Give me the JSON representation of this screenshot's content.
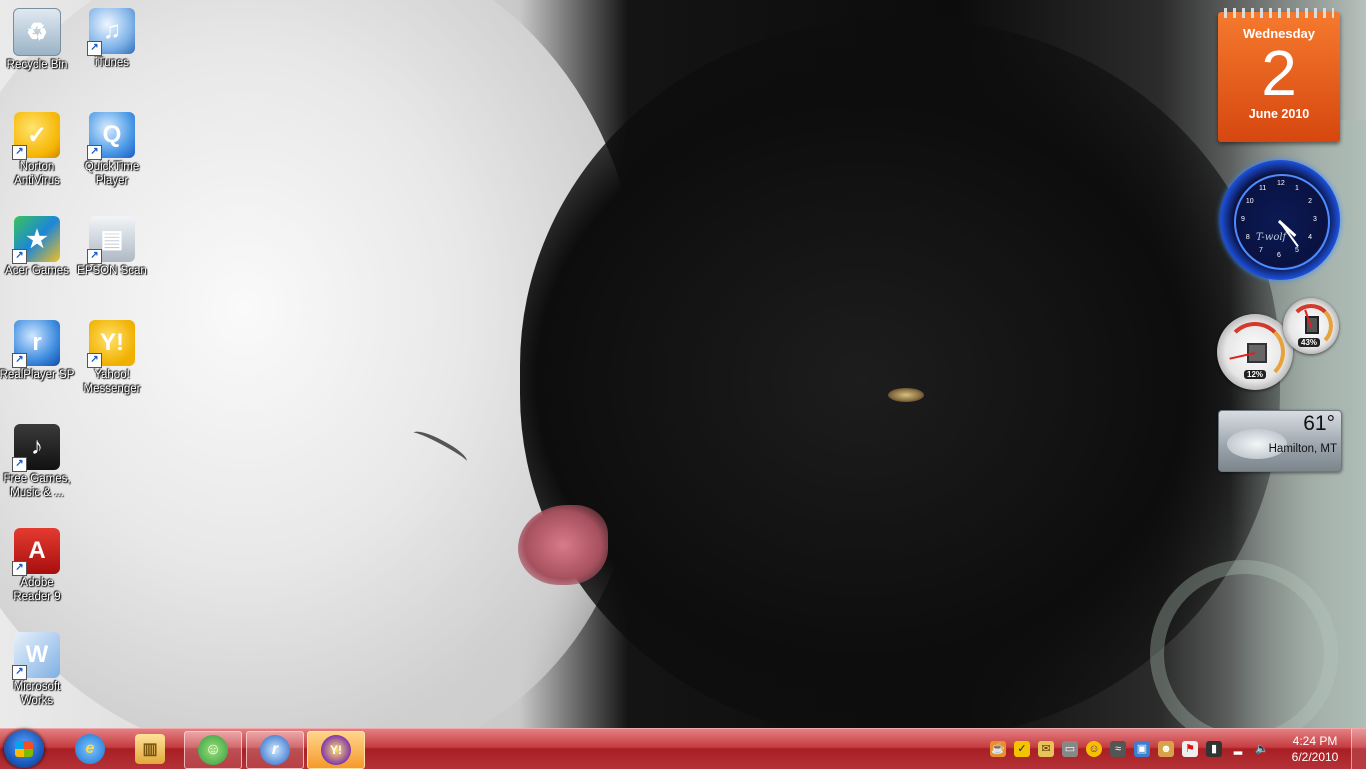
{
  "desktop": {
    "icons": [
      {
        "label": "Recycle Bin",
        "icon": "recycle-bin-icon",
        "glyph": "♻"
      },
      {
        "label": "iTunes",
        "icon": "itunes-icon",
        "glyph": "♫"
      },
      {
        "label": "Norton AntiVirus",
        "icon": "norton-antivirus-icon",
        "glyph": "✓"
      },
      {
        "label": "QuickTime Player",
        "icon": "quicktime-icon",
        "glyph": "Q"
      },
      {
        "label": "Acer Games",
        "icon": "acer-games-icon",
        "glyph": "★"
      },
      {
        "label": "EPSON Scan",
        "icon": "epson-scan-icon",
        "glyph": "▤"
      },
      {
        "label": "RealPlayer SP",
        "icon": "realplayer-icon",
        "glyph": "r"
      },
      {
        "label": "Yahoo! Messenger",
        "icon": "yahoo-messenger-icon",
        "glyph": "Y!"
      },
      {
        "label": "Free Games, Music & ...",
        "icon": "free-games-icon",
        "glyph": "♪"
      },
      {
        "label": "Adobe Reader 9",
        "icon": "adobe-reader-icon",
        "glyph": "A"
      },
      {
        "label": "Microsoft Works",
        "icon": "microsoft-works-icon",
        "glyph": "W"
      }
    ]
  },
  "gadgets": {
    "calendar": {
      "weekday": "Wednesday",
      "day": "2",
      "month_year": "June 2010"
    },
    "clock": {
      "brand": "T-wolf",
      "hour": 4,
      "minute": 24,
      "numbers": [
        "12",
        "1",
        "2",
        "3",
        "4",
        "5",
        "6",
        "7",
        "8",
        "9",
        "10",
        "11"
      ]
    },
    "cpu_meter": {
      "cpu_percent": "12%",
      "memory_percent": "43%",
      "cpu_value": 12,
      "memory_value": 43
    },
    "weather": {
      "temperature": "61°",
      "location": "Hamilton, MT"
    }
  },
  "taskbar": {
    "colors": {
      "base": "#b02a2f",
      "highlight": "#e37f81"
    },
    "pinned": [
      {
        "name": "internet-explorer",
        "icon": "internet-explorer-icon",
        "glyph": "e"
      },
      {
        "name": "windows-explorer",
        "icon": "folder-icon",
        "glyph": "▥"
      },
      {
        "name": "windows-live-messenger",
        "icon": "messenger-icon",
        "glyph": "☺"
      },
      {
        "name": "realplayer",
        "icon": "realplayer-icon",
        "glyph": "r"
      },
      {
        "name": "yahoo-messenger",
        "icon": "yahoo-messenger-icon",
        "glyph": "Y!"
      }
    ],
    "tray": [
      {
        "name": "tray-java",
        "icon": "java-icon",
        "glyph": "☕"
      },
      {
        "name": "tray-norton",
        "icon": "norton-icon",
        "glyph": "✓"
      },
      {
        "name": "tray-mail",
        "icon": "mail-icon",
        "glyph": "✉"
      },
      {
        "name": "tray-display",
        "icon": "display-icon",
        "glyph": "▭"
      },
      {
        "name": "tray-yahoo",
        "icon": "yahoo-icon",
        "glyph": "☺"
      },
      {
        "name": "tray-bluetooth",
        "icon": "wireless-icon",
        "glyph": "≈"
      },
      {
        "name": "tray-devices",
        "icon": "devices-icon",
        "glyph": "▣"
      },
      {
        "name": "tray-user",
        "icon": "user-icon",
        "glyph": "☻"
      },
      {
        "name": "tray-action-center",
        "icon": "action-center-flag-icon",
        "glyph": "⚑"
      },
      {
        "name": "tray-power",
        "icon": "power-icon",
        "glyph": "▮"
      },
      {
        "name": "tray-network",
        "icon": "network-signal-icon",
        "glyph": "▂"
      },
      {
        "name": "tray-volume",
        "icon": "volume-icon",
        "glyph": "🔈"
      }
    ],
    "time": "4:24 PM",
    "date": "6/2/2010"
  }
}
